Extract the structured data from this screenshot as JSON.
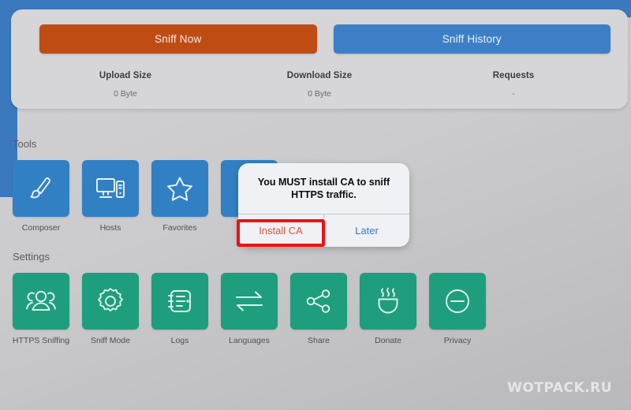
{
  "theme": {
    "blue_tile": "#3280c4",
    "green_tile": "#1f9e7e",
    "sniff_now_bg": "#bf4d13",
    "sniff_history_bg": "#3d7fc6",
    "chrome_blue": "#3b79be",
    "annotation_red": "#ee1111",
    "dialog_primary": "#e2513c",
    "dialog_secondary": "#2b7de0"
  },
  "summary": {
    "sniff_now_label": "Sniff Now",
    "sniff_history_label": "Sniff History",
    "stats": [
      {
        "label": "Upload Size",
        "value": "0 Byte"
      },
      {
        "label": "Download Size",
        "value": "0 Byte"
      },
      {
        "label": "Requests",
        "value": "-"
      }
    ]
  },
  "tools": {
    "title": "Tools",
    "items": [
      {
        "label": "Composer",
        "icon": "paintbrush-icon"
      },
      {
        "label": "Hosts",
        "icon": "monitor-tower-icon"
      },
      {
        "label": "Favorites",
        "icon": "star-icon"
      },
      {
        "label": "",
        "icon": "hidden-tile-icon"
      }
    ]
  },
  "settings": {
    "title": "Settings",
    "items": [
      {
        "label": "HTTPS Sniffing",
        "icon": "people-group-icon"
      },
      {
        "label": "Sniff Mode",
        "icon": "gear-icon"
      },
      {
        "label": "Logs",
        "icon": "notebook-icon"
      },
      {
        "label": "Languages",
        "icon": "exchange-arrows-icon"
      },
      {
        "label": "Share",
        "icon": "share-nodes-icon"
      },
      {
        "label": "Donate",
        "icon": "coffee-cup-icon"
      },
      {
        "label": "Privacy",
        "icon": "circle-minus-icon"
      }
    ]
  },
  "dialog": {
    "message": "You MUST install CA to sniff HTTPS traffic.",
    "primary_label": "Install CA",
    "secondary_label": "Later"
  },
  "watermark": {
    "text": "WOTPACK.RU"
  }
}
